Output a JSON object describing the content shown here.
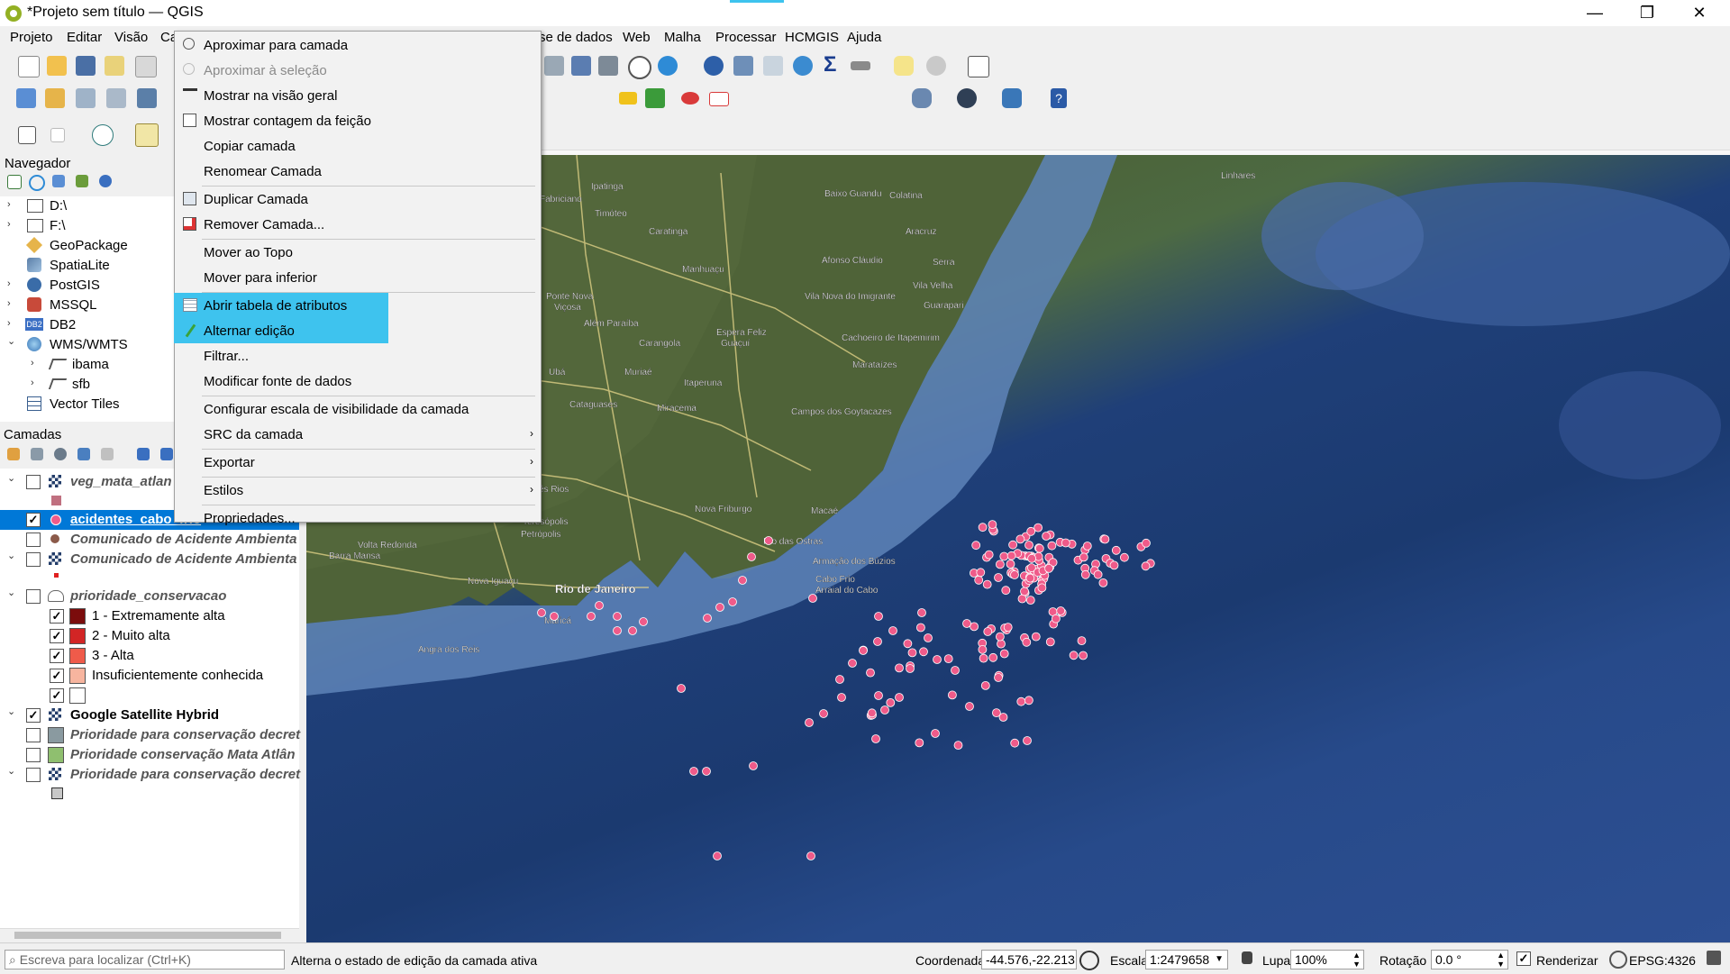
{
  "window": {
    "title": "*Projeto sem título — QGIS",
    "minimize": "—",
    "maximize": "❐",
    "close": "✕"
  },
  "menubar": {
    "items": [
      "Projeto",
      "Editar",
      "Visão",
      "Ca",
      "se de dados",
      "Web",
      "Malha",
      "Processar",
      "HCMGIS",
      "Ajuda"
    ]
  },
  "navigator": {
    "title": "Navegador",
    "items": [
      {
        "label": "D:\\",
        "icon": "folder-icon",
        "expand": "›"
      },
      {
        "label": "F:\\",
        "icon": "folder-icon",
        "expand": "›"
      },
      {
        "label": "GeoPackage",
        "icon": "geopackage-icon",
        "expand": ""
      },
      {
        "label": "SpatiaLite",
        "icon": "spatialite-icon",
        "expand": ""
      },
      {
        "label": "PostGIS",
        "icon": "postgis-icon",
        "expand": "›"
      },
      {
        "label": "MSSQL",
        "icon": "mssql-icon",
        "expand": "›"
      },
      {
        "label": "DB2",
        "icon": "db2-icon",
        "expand": "›"
      },
      {
        "label": "WMS/WMTS",
        "icon": "globe-icon",
        "expand": "⌄"
      },
      {
        "label": "ibama",
        "icon": "wms-icon",
        "expand": "›"
      },
      {
        "label": "sfb",
        "icon": "wms-icon",
        "expand": "›"
      },
      {
        "label": "Vector Tiles",
        "icon": "grid-icon",
        "expand": ""
      }
    ]
  },
  "layers": {
    "title": "Camadas",
    "items": [
      {
        "label": "veg_mata_atlan",
        "style": "italic",
        "checked": false,
        "expand": "⌄"
      },
      {
        "label": "acidentes_cabo_frio",
        "style": "selected",
        "checked": true,
        "expand": ""
      },
      {
        "label": "Comunicado de Acidente Ambienta",
        "style": "italic",
        "checked": false,
        "expand": ""
      },
      {
        "label": "Comunicado de Acidente Ambienta",
        "style": "italic",
        "checked": false,
        "expand": "⌄"
      },
      {
        "label": "prioridade_conservacao",
        "style": "italic",
        "checked": false,
        "expand": "⌄"
      },
      {
        "label": "1 - Extremamente alta",
        "style": "legend",
        "checked": true,
        "color": "#7b0c0c"
      },
      {
        "label": "2 - Muito alta",
        "style": "legend",
        "checked": true,
        "color": "#d22525"
      },
      {
        "label": "3 - Alta",
        "style": "legend",
        "checked": true,
        "color": "#ef5b4a"
      },
      {
        "label": "Insuficientemente conhecida",
        "style": "legend",
        "checked": true,
        "color": "#f7b59f"
      },
      {
        "label": "",
        "style": "legend",
        "checked": true,
        "color": "#ffffff"
      },
      {
        "label": "Google Satellite Hybrid",
        "style": "bold",
        "checked": true,
        "expand": "⌄"
      },
      {
        "label": "Prioridade para conservação decret",
        "style": "italic",
        "checked": false,
        "expand": ""
      },
      {
        "label": "Prioridade conservação Mata Atlân",
        "style": "italic",
        "checked": false,
        "expand": ""
      },
      {
        "label": "Prioridade para conservação decret",
        "style": "italic",
        "checked": false,
        "expand": "⌄"
      }
    ]
  },
  "context_menu": {
    "items": [
      {
        "label": "Aproximar para camada",
        "icon": "zoom-layer-icon",
        "disabled": false
      },
      {
        "label": "Aproximar à seleção",
        "icon": "zoom-selection-icon",
        "disabled": true
      },
      {
        "label": "Mostrar na visão geral",
        "icon": "overview-icon",
        "disabled": false
      },
      {
        "label": "Mostrar contagem da feição",
        "icon": "checkbox-icon",
        "disabled": false
      },
      {
        "label": "Copiar camada",
        "icon": "",
        "disabled": false
      },
      {
        "label": "Renomear Camada",
        "icon": "",
        "disabled": false,
        "sep_after": true
      },
      {
        "label": "Duplicar Camada",
        "icon": "duplicate-icon",
        "disabled": false
      },
      {
        "label": "Remover Camada...",
        "icon": "remove-layer-icon",
        "disabled": false,
        "sep_after": true
      },
      {
        "label": "Mover ao Topo",
        "icon": "",
        "disabled": false
      },
      {
        "label": "Mover para inferior",
        "icon": "",
        "disabled": false,
        "sep_after": true
      },
      {
        "label": "Abrir tabela de atributos",
        "icon": "attribute-table-icon",
        "disabled": false,
        "highlight": true
      },
      {
        "label": "Alternar edição",
        "icon": "pencil-icon",
        "disabled": false,
        "highlight": true
      },
      {
        "label": "Filtrar...",
        "icon": "",
        "disabled": false
      },
      {
        "label": "Modificar fonte de dados",
        "icon": "",
        "disabled": false,
        "sep_after": true
      },
      {
        "label": "Configurar escala de visibilidade da camada",
        "icon": "",
        "disabled": false
      },
      {
        "label": "SRC da camada",
        "icon": "",
        "disabled": false,
        "submenu": "›",
        "sep_after": true
      },
      {
        "label": "Exportar",
        "icon": "",
        "disabled": false,
        "submenu": "›",
        "sep_after": true
      },
      {
        "label": "Estilos",
        "icon": "",
        "disabled": false,
        "submenu": "›",
        "sep_after": true
      },
      {
        "label": "Propriedades...",
        "icon": "",
        "disabled": false
      }
    ]
  },
  "map": {
    "place_labels": [
      "Linhares",
      "Ipatinga",
      "Fabriciano",
      "Timóteo",
      "Caratinga",
      "Baixo Guandu",
      "Colatina",
      "Aracruz",
      "Serra",
      "Vila Velha",
      "Guarapari",
      "Manhuaçu",
      "Vila Nova do Imigrante",
      "Afonso Cláudio",
      "Espera Feliz",
      "Cachoeiro de Itapemirim",
      "Marataízes",
      "Viçosa",
      "Ubá",
      "Muriaé",
      "Itaperuna",
      "Cataguases",
      "Miracema",
      "Campos dos Goytacazes",
      "Três Rios",
      "Nova Friburgo",
      "Teresópolis",
      "Petrópolis",
      "Volta Redonda",
      "Barra Mansa",
      "Nova Iguaçu",
      "Rio de Janeiro",
      "Maricá",
      "Angra dos Reis",
      "Macaé",
      "Rio das Ostras",
      "Armação dos Búzios",
      "Cabo Frio",
      "Arraial do Cabo",
      "Ponte Nova",
      "Além Paraíba",
      "Carangola",
      "Guaçuí"
    ]
  },
  "statusbar": {
    "search_placeholder": "Escreva para localizar (Ctrl+K)",
    "message": "Alterna o estado de edição da camada ativa",
    "coord_label": "Coordenada",
    "coord_value": "-44.576,-22.213",
    "scale_label": "Escala",
    "scale_value": "1:2479658",
    "magnifier_label": "Lupa",
    "magnifier_value": "100%",
    "rotation_label": "Rotação",
    "rotation_value": "0.0 °",
    "render_label": "Renderizar",
    "crs": "EPSG:4326"
  },
  "colors": {
    "highlight": "#3ec3ee",
    "selected_row": "#0078d7",
    "point_fill": "#ef5b8a",
    "point_stroke": "#ffffff"
  }
}
